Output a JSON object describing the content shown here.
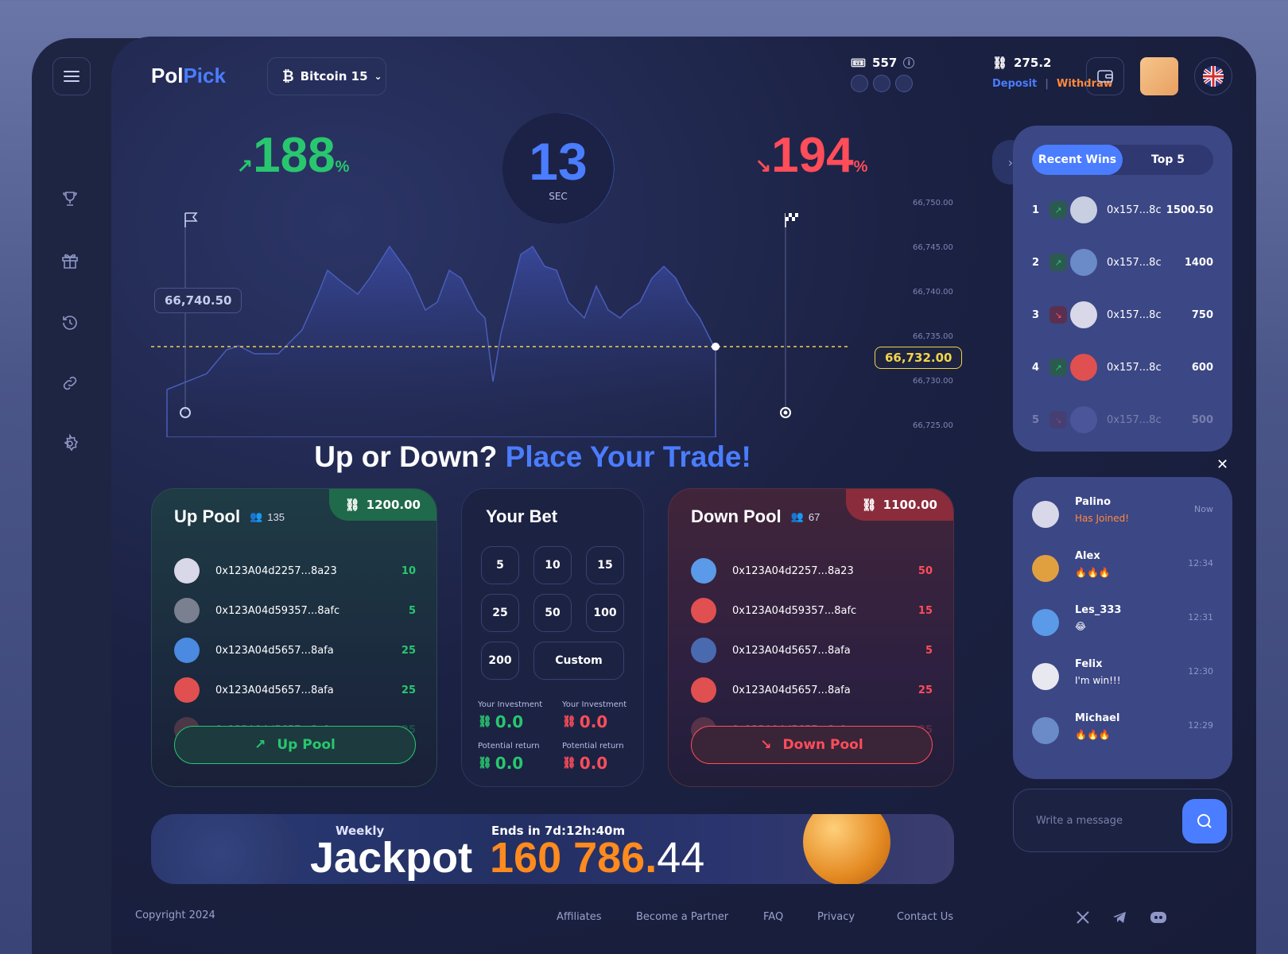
{
  "brand": {
    "part1": "Pol",
    "part2": "Pick"
  },
  "coin_selector": {
    "label": "Bitcoin 15"
  },
  "tickets": {
    "count": "557"
  },
  "balance": {
    "amount": "275.2",
    "deposit": "Deposit",
    "withdraw": "Withdraw"
  },
  "round": {
    "up_pct": "188",
    "down_pct": "194",
    "pct_sign": "%",
    "timer": "13",
    "timer_unit": "SEC",
    "start_price": "66,740.50",
    "current_price": "66,732.00"
  },
  "price_axis": [
    "66,750.00",
    "66,745.00",
    "66,740.00",
    "66,735.00",
    "66,730.00",
    "66,725.00"
  ],
  "headline": {
    "part1": "Up or Down?",
    "part2": "Place Your Trade!"
  },
  "up_pool": {
    "title": "Up Pool",
    "players": "135",
    "amount": "1200.00",
    "button": "Up Pool",
    "rows": [
      {
        "addr": "0x123A04d2257...8a23",
        "amt": "10"
      },
      {
        "addr": "0x123A04d59357...8afc",
        "amt": "5"
      },
      {
        "addr": "0x123A04d5657...8afa",
        "amt": "25"
      },
      {
        "addr": "0x123A04d5657...8afa",
        "amt": "25"
      },
      {
        "addr": "0x123A04d5657...8afa",
        "amt": "25"
      }
    ]
  },
  "down_pool": {
    "title": "Down Pool",
    "players": "67",
    "amount": "1100.00",
    "button": "Down Pool",
    "rows": [
      {
        "addr": "0x123A04d2257...8a23",
        "amt": "50"
      },
      {
        "addr": "0x123A04d59357...8afc",
        "amt": "15"
      },
      {
        "addr": "0x123A04d5657...8afa",
        "amt": "5"
      },
      {
        "addr": "0x123A04d5657...8afa",
        "amt": "25"
      },
      {
        "addr": "0x123A04d5657...8afa",
        "amt": "25"
      }
    ]
  },
  "your_bet": {
    "title": "Your Bet",
    "options": [
      "5",
      "10",
      "15",
      "25",
      "50",
      "100",
      "200",
      "Custom"
    ],
    "inv_label": "Your Investment",
    "ret_label": "Potential return",
    "up_inv": "0.0",
    "down_inv": "0.0",
    "up_ret": "0.0",
    "down_ret": "0.0"
  },
  "jackpot": {
    "weekly": "Weekly",
    "title": "Jackpot",
    "ends": "Ends in 7d:12h:40m",
    "amount_main": "160 786.",
    "amount_dec": "44"
  },
  "footer": {
    "copyright": "Copyright 2024",
    "links": [
      "Affiliates",
      "Become a Partner",
      "FAQ",
      "Privacy",
      "Contact Us"
    ]
  },
  "wins": {
    "tabs": [
      "Recent Wins",
      "Top 5"
    ],
    "rows": [
      {
        "rank": "1",
        "addr": "0x157...8c",
        "amt": "1500.50",
        "dir": "up"
      },
      {
        "rank": "2",
        "addr": "0x157...8c",
        "amt": "1400",
        "dir": "up"
      },
      {
        "rank": "3",
        "addr": "0x157...8c",
        "amt": "750",
        "dir": "down"
      },
      {
        "rank": "4",
        "addr": "0x157...8c",
        "amt": "600",
        "dir": "up"
      },
      {
        "rank": "5",
        "addr": "0x157...8c",
        "amt": "500",
        "dir": "down"
      }
    ]
  },
  "chat": {
    "messages": [
      {
        "name": "Palino",
        "text": "Has Joined!",
        "time": "Now"
      },
      {
        "name": "Alex",
        "text": "🔥🔥🔥",
        "time": "12:34"
      },
      {
        "name": "Les_333",
        "text": "😂",
        "time": "12:31"
      },
      {
        "name": "Felix",
        "text": "I'm win!!!",
        "time": "12:30"
      },
      {
        "name": "Michael",
        "text": "🔥🔥🔥",
        "time": "12:29"
      }
    ],
    "placeholder": "Write a message"
  },
  "colors": {
    "up": "#28c76f",
    "down": "#ff4d5a",
    "accent": "#4a7dff",
    "jackpot": "#ff8a1e"
  }
}
